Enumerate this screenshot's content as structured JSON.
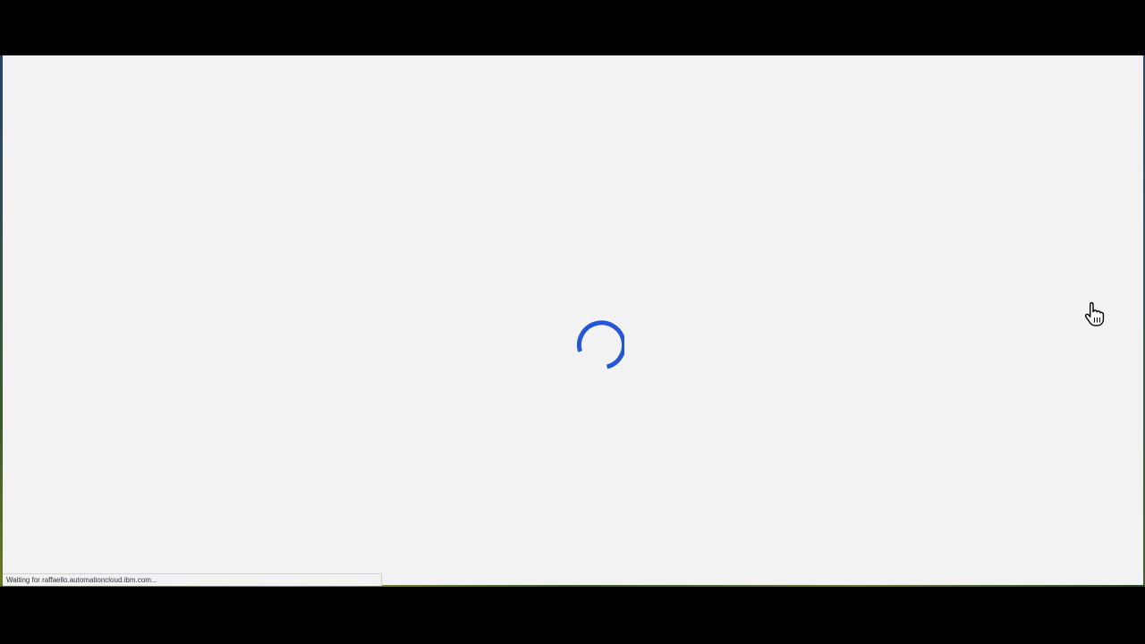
{
  "browser": {
    "status_text": "Waiting for raffaello.automationcloud.ibm.com..."
  },
  "loading": {
    "icon": "loading-spinner-icon",
    "color": "#2457d6"
  },
  "cursor": {
    "icon": "hand-pointer-icon"
  },
  "colors": {
    "page_background": "#f2f2f2",
    "frame": "#000000"
  }
}
